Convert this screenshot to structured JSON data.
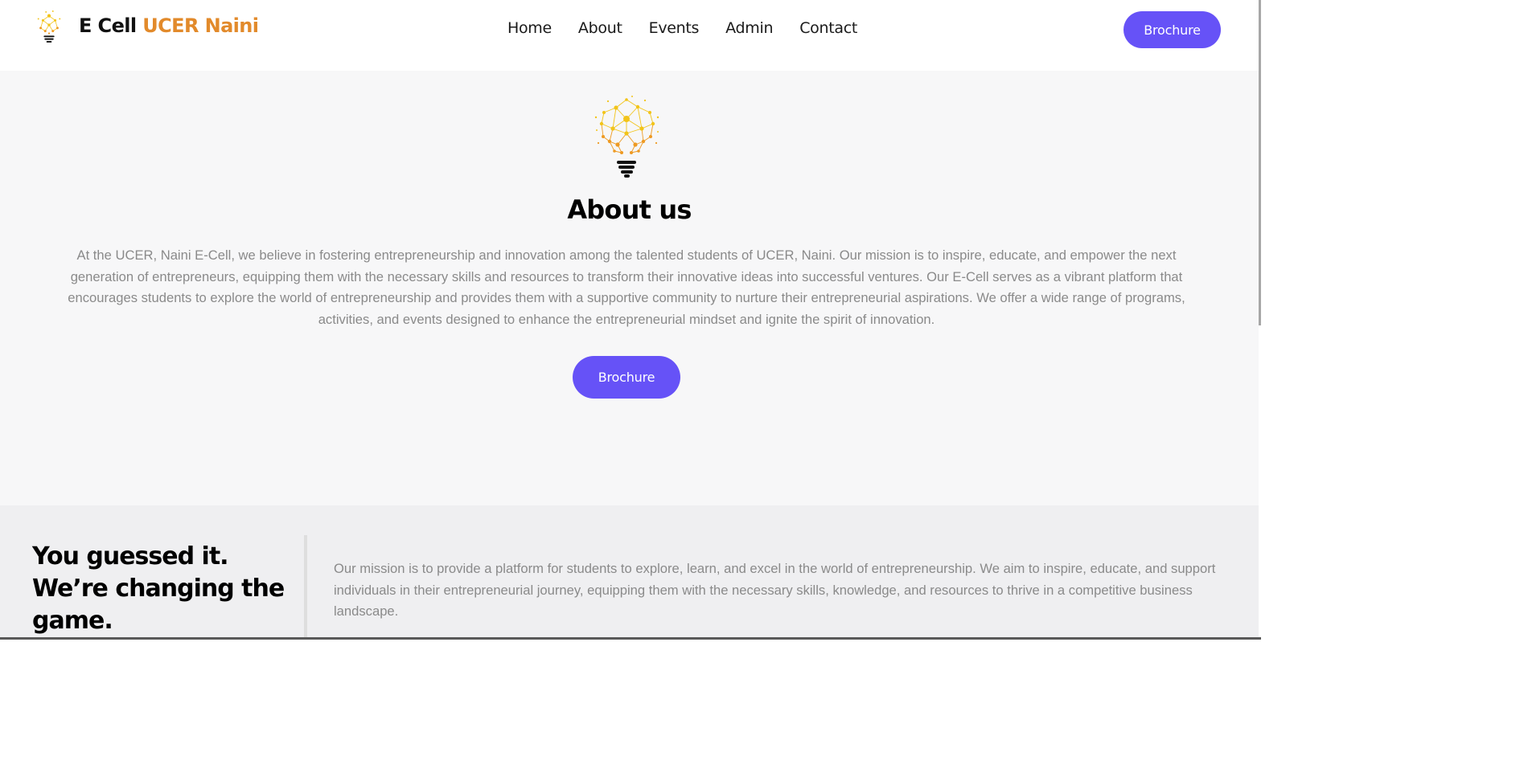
{
  "header": {
    "logo": {
      "brand": "E Cell",
      "brand_accent": "UCER Naini"
    },
    "nav": [
      {
        "label": "Home"
      },
      {
        "label": "About"
      },
      {
        "label": "Events"
      },
      {
        "label": "Admin"
      },
      {
        "label": "Contact"
      }
    ],
    "cta_label": "Brochure"
  },
  "about": {
    "title": "About us",
    "text": "At the UCER, Naini E-Cell, we believe in fostering entrepreneurship and innovation among the talented students of UCER, Naini. Our mission is to inspire, educate, and empower the next generation of entrepreneurs, equipping them with the necessary skills and resources to transform their innovative ideas into successful ventures. Our E-Cell serves as a vibrant platform that encourages students to explore the world of entrepreneurship and provides them with a supportive community to nurture their entrepreneurial aspirations. We offer a wide range of programs, activities, and events designed to enhance the entrepreneurial mindset and ignite the spirit of innovation.",
    "button_label": "Brochure"
  },
  "mission": {
    "heading": "You guessed it. We’re changing the game.",
    "text": "Our mission is to provide a platform for students to explore, learn, and excel in the world of entrepreneurship. We aim to inspire, educate, and support individuals in their entrepreneurial journey, equipping them with the necessary skills, knowledge, and resources to thrive in a competitive business landscape."
  },
  "colors": {
    "accent": "#6652f7",
    "brand_orange": "#e28a2b",
    "bulb_yellow": "#f2c419",
    "bulb_orange": "#ee9a23"
  },
  "icons": {
    "logo": "lightbulb-network-icon",
    "hero": "lightbulb-network-icon"
  }
}
